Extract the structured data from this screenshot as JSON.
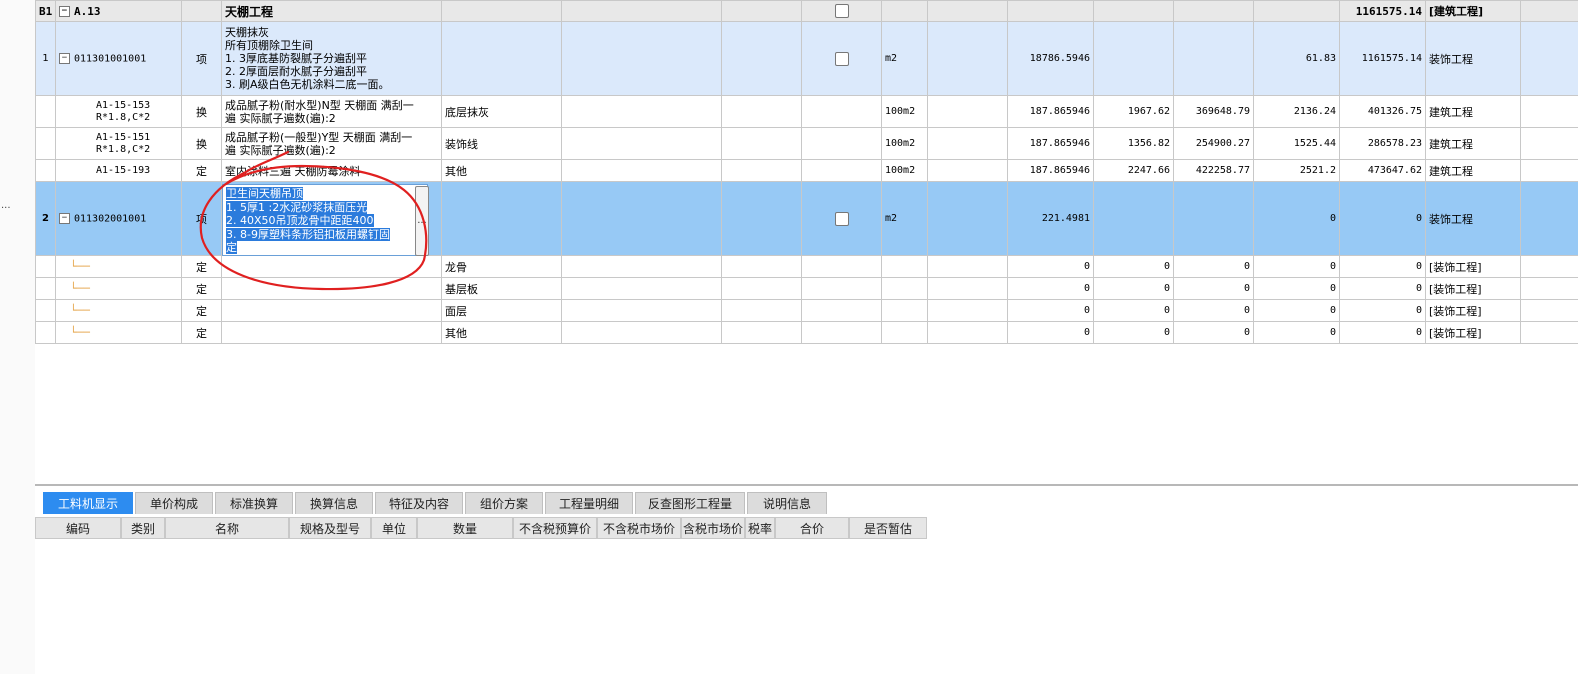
{
  "grid": {
    "section": {
      "code": "B1",
      "name": "A.13",
      "title": "天棚工程",
      "total": "1161575.14",
      "category": "[建筑工程]"
    },
    "items": [
      {
        "rownum": "1",
        "code": "011301001001",
        "type": "项",
        "desc": [
          "天棚抹灰",
          "所有顶棚除卫生间",
          "1. 3厚底基防裂腻子分遍刮平",
          "2. 2厚面层耐水腻子分遍刮平",
          "3. 刷A级白色无机涂料二底一面。"
        ],
        "unit": "m2",
        "qty": "18786.5946",
        "c13": "61.83",
        "c14": "1161575.14",
        "category": "装饰工程",
        "children": [
          {
            "code": "A1-15-153",
            "code2": "R*1.8,C*2",
            "type": "换",
            "desc": [
              "成品腻子粉(耐水型)N型 天棚面 满刮一",
              "遍  实际腻子遍数(遍):2"
            ],
            "feature": "底层抹灰",
            "unit": "100m2",
            "qty": "187.865946",
            "c11": "1967.62",
            "c12": "369648.79",
            "c13": "2136.24",
            "c14": "401326.75",
            "category": "建筑工程"
          },
          {
            "code": "A1-15-151",
            "code2": "R*1.8,C*2",
            "type": "换",
            "desc": [
              "成品腻子粉(一般型)Y型 天棚面 满刮一",
              "遍  实际腻子遍数(遍):2"
            ],
            "feature": "装饰线",
            "unit": "100m2",
            "qty": "187.865946",
            "c11": "1356.82",
            "c12": "254900.27",
            "c13": "1525.44",
            "c14": "286578.23",
            "category": "建筑工程"
          },
          {
            "code": "A1-15-193",
            "type": "定",
            "desc": [
              "室内涂料三遍 天棚防霉涂料"
            ],
            "feature": "其他",
            "unit": "100m2",
            "qty": "187.865946",
            "c11": "2247.66",
            "c12": "422258.77",
            "c13": "2521.2",
            "c14": "473647.62",
            "category": "建筑工程"
          }
        ]
      },
      {
        "rownum": "2",
        "code": "011302001001",
        "type": "项",
        "desc": [
          "卫生间天棚吊顶",
          "1.  5厚1 :2水泥砂浆抹面压光",
          "2.  40X50吊顶龙骨中距距400",
          "3.  8-9厚塑料条形铝扣板用螺钉固",
          "定"
        ],
        "unit": "m2",
        "qty": "221.4981",
        "c13": "0",
        "c14": "0",
        "category": "装饰工程",
        "children": [
          {
            "type": "定",
            "feature": "龙骨",
            "qty": "0",
            "c11": "0",
            "c12": "0",
            "c13": "0",
            "c14": "0",
            "category": "[装饰工程]"
          },
          {
            "type": "定",
            "feature": "基层板",
            "qty": "0",
            "c11": "0",
            "c12": "0",
            "c13": "0",
            "c14": "0",
            "category": "[装饰工程]"
          },
          {
            "type": "定",
            "feature": "面层",
            "qty": "0",
            "c11": "0",
            "c12": "0",
            "c13": "0",
            "c14": "0",
            "category": "[装饰工程]"
          },
          {
            "type": "定",
            "feature": "其他",
            "qty": "0",
            "c11": "0",
            "c12": "0",
            "c13": "0",
            "c14": "0",
            "category": "[装饰工程]"
          }
        ]
      }
    ]
  },
  "leftstrip": {
    "dots": "..."
  },
  "editor": {
    "button": "..."
  },
  "bottom": {
    "tabs": [
      "工料机显示",
      "单价构成",
      "标准换算",
      "换算信息",
      "特征及内容",
      "组价方案",
      "工程量明细",
      "反查图形工程量",
      "说明信息"
    ],
    "headers": [
      "编码",
      "类别",
      "名称",
      "规格及型号",
      "单位",
      "数量",
      "不含税预算价",
      "不含税市场价",
      "含税市场价",
      "税率",
      "合价",
      "是否暂估"
    ]
  },
  "colors": {
    "selected_row": "#97c9f5",
    "light_row": "#dbe9fb",
    "active_tab": "#2d8cf0",
    "annotation": "#e02020"
  }
}
